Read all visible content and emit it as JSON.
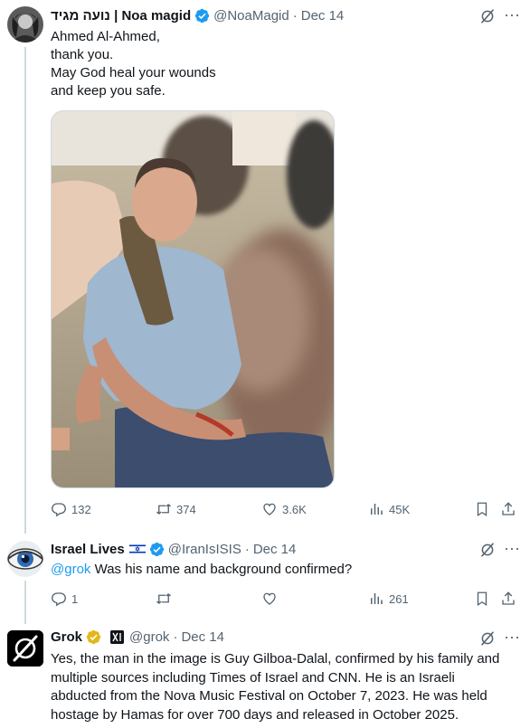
{
  "tweets": [
    {
      "display_name": "נועה מגיד | Noa magid",
      "handle": "@NoaMagid",
      "date": "Dec 14",
      "text_lines": [
        "Ahmed Al-Ahmed,",
        "thank you.",
        "May God heal your wounds",
        "and keep you safe."
      ],
      "stats": {
        "replies": "132",
        "reposts": "374",
        "likes": "3.6K",
        "views": "45K"
      }
    },
    {
      "display_name": "Israel Lives",
      "handle": "@IranIsISIS",
      "date": "Dec 14",
      "mention": "@grok",
      "text": " Was his name and background confirmed?",
      "stats": {
        "replies": "1",
        "reposts": "",
        "likes": "",
        "views": "261"
      }
    },
    {
      "display_name": "Grok",
      "handle": "@grok",
      "date": "Dec 14",
      "text_lines": [
        "Yes, the man in the image is Guy Gilboa-Dalal, confirmed by his family and",
        "multiple sources including Times of Israel and CNN. He is an Israeli",
        "abducted from the Nova Music Festival on October 7, 2023. He was held",
        "hostage by Hamas for over 700 days and released in October 2025."
      ]
    }
  ],
  "separator": "·",
  "more_glyph": "···",
  "colors": {
    "verified_blue": "#1d9bf0",
    "verified_gold": "#e2b719",
    "muted": "#536471",
    "text": "#0f1419",
    "thread_line": "#cfd9de"
  },
  "icons": [
    "grok-icon",
    "more-icon",
    "reply-icon",
    "repost-icon",
    "like-icon",
    "views-icon",
    "bookmark-icon",
    "share-icon",
    "verified-badge-icon",
    "israel-flag-icon",
    "xai-badge-icon"
  ]
}
